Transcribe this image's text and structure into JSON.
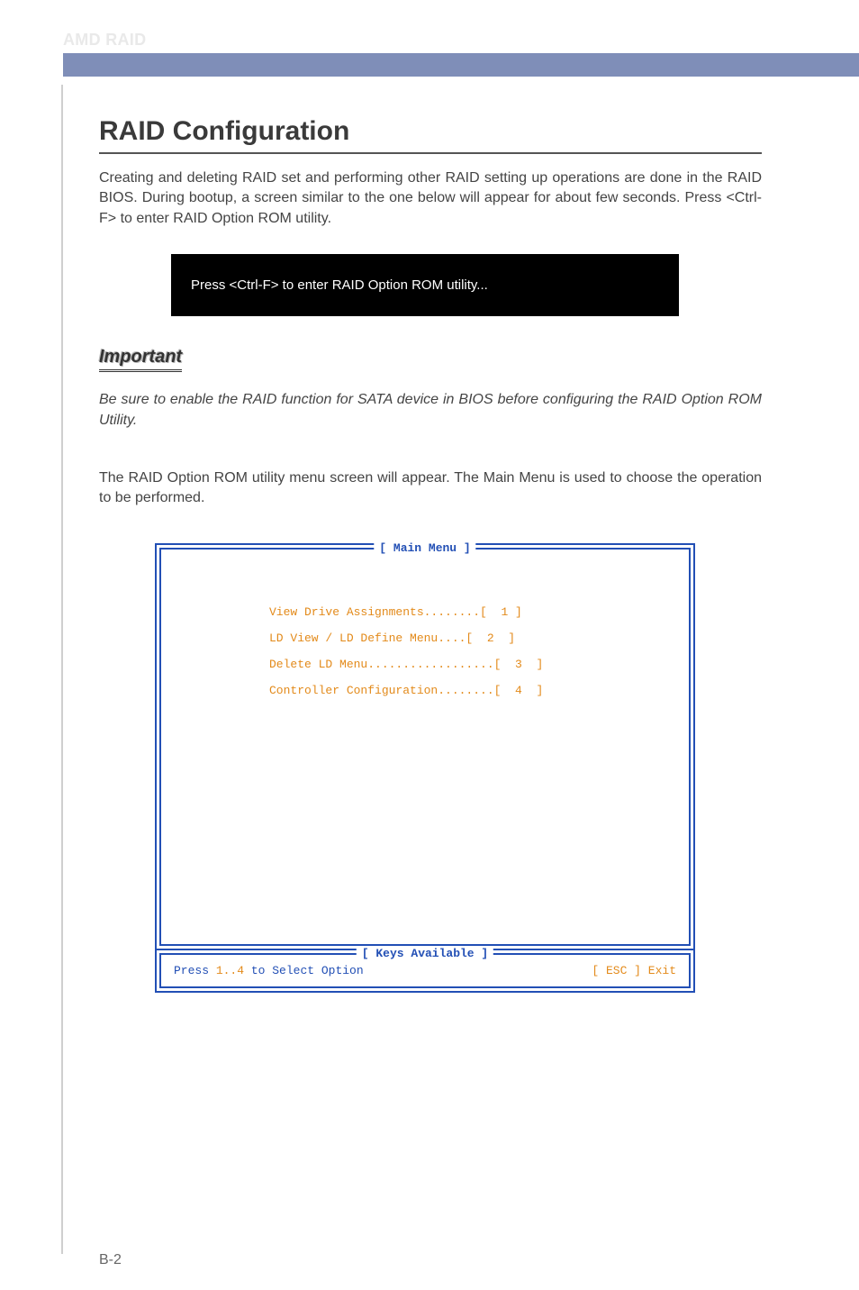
{
  "header": {
    "title": "AMD RAID"
  },
  "section": {
    "title": "RAID Configuration",
    "intro": "Creating and deleting RAID set and performing other RAID setting up operations are done in the RAID BIOS. During bootup, a screen similar to the one below will appear for about few seconds. Press <Ctrl-F> to enter RAID Option ROM utility.",
    "black_box": "Press <Ctrl-F> to enter RAID Option ROM utility...",
    "important_label": "Important",
    "important_text": "Be sure to enable the RAID function for SATA device in BIOS before configuring the RAID Option ROM Utility.",
    "caption": "The RAID Option ROM utility menu screen will appear. The Main Menu is used to choose the operation to be performed."
  },
  "bios": {
    "main_title": "[ Main Menu ]",
    "menu": [
      "View Drive Assignments........[  1 ]",
      "LD View / LD Define Menu....[  2  ]",
      "Delete LD Menu..................[  3  ]",
      "Controller Configuration........[  4  ]"
    ],
    "keys_title": "[ Keys Available ]",
    "keys_left_prefix": "Press ",
    "keys_left_range": "1..4",
    "keys_left_suffix": " to Select Option",
    "keys_right": "[ ESC ]  Exit"
  },
  "page_number": "B-2"
}
